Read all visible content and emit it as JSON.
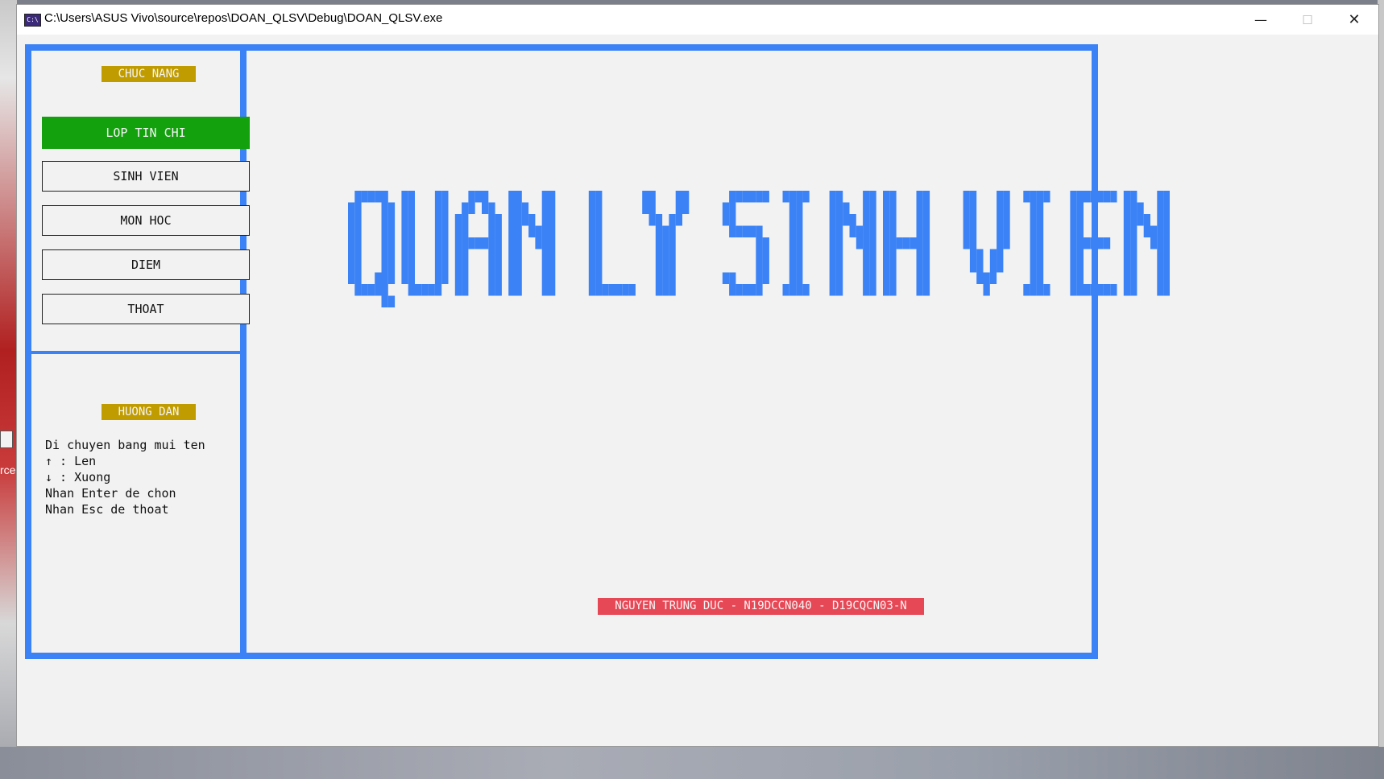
{
  "window": {
    "title": "C:\\Users\\ASUS Vivo\\source\\repos\\DOAN_QLSV\\Debug\\DOAN_QLSV.exe",
    "app_icon_text": "C:\\",
    "minimize": "—",
    "maximize": "☐",
    "close": "✕"
  },
  "desktop": {
    "icon_label": "rce"
  },
  "sidebar": {
    "section_title": "CHUC NANG",
    "menu": [
      {
        "label": "LOP TIN CHI",
        "selected": true
      },
      {
        "label": "SINH VIEN",
        "selected": false
      },
      {
        "label": "MON HOC",
        "selected": false
      },
      {
        "label": "DIEM",
        "selected": false
      },
      {
        "label": "THOAT",
        "selected": false
      }
    ]
  },
  "guide": {
    "section_title": "HUONG DAN",
    "lines": [
      "Di chuyen bang mui ten",
      "↑ : Len",
      "↓ : Xuong",
      "Nhan Enter de chon",
      "Nhan Esc de thoat"
    ]
  },
  "main": {
    "banner_text": "QUAN LY SINH VIEN",
    "footer": "NGUYEN TRUNG DUC - N19DCCN040 - D19CQCN03-N"
  },
  "colors": {
    "frame": "#3b82f6",
    "label_bg": "#c19c00",
    "active_bg": "#13a10e",
    "footer_bg": "#e74856",
    "console_bg": "#f2f2f2"
  }
}
